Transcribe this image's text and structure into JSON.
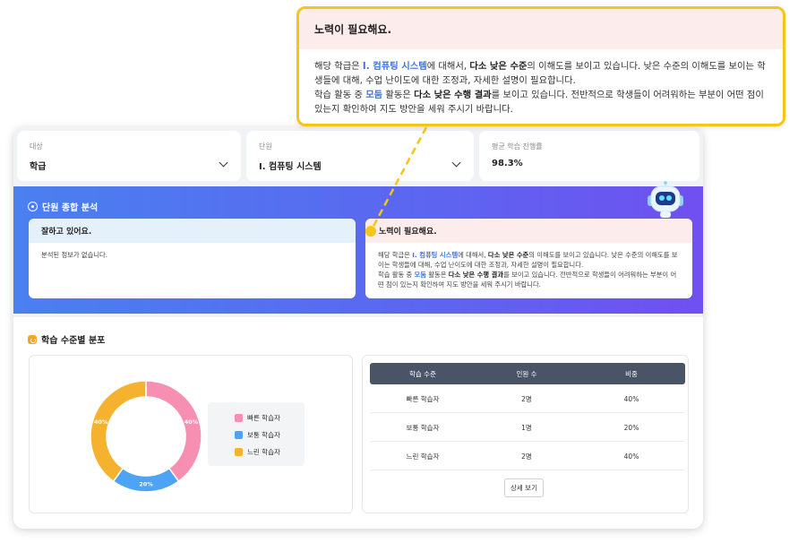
{
  "filters": [
    {
      "label": "대상",
      "value": "학급",
      "has_dropdown": true
    },
    {
      "label": "단원",
      "value": "I. 컴퓨팅 시스템",
      "has_dropdown": true
    },
    {
      "label": "평균 학습 진행률",
      "value": "98.3%",
      "has_dropdown": false
    }
  ],
  "analysis": {
    "title": "단원 종합 분석",
    "good": {
      "header": "잘하고 있어요.",
      "body": "분석된 정보가 없습니다."
    },
    "needs": {
      "header": "노력이 필요해요.",
      "p1_pre": "해당 학급은 ",
      "p1_unit": "I. 컴퓨팅 시스템",
      "p1_mid": "에 대해서, ",
      "p1_bold": "다소 낮은 수준",
      "p1_post": "의 이해도를 보이고 있습니다. 낮은 수준의 이해도를 보이는 학생들에 대해, 수업 난이도에 대한 조정과, 자세한 설명이 필요합니다.",
      "p2_pre": "학습 활동 중 ",
      "p2_act": "모둠",
      "p2_mid": " 활동은 ",
      "p2_bold": "다소 낮은 수행 결과",
      "p2_post": "를 보이고 있습니다. 전반적으로 학생들이 어려워하는 부분이 어떤 점이 있는지 확인하여 지도 방안을 세워 주시기 바랍니다."
    }
  },
  "distribution": {
    "title": "학습 수준별 분포",
    "legend": [
      {
        "name": "빠른 학습자",
        "color": "#f78fb3"
      },
      {
        "name": "보통 학습자",
        "color": "#4da3f5"
      },
      {
        "name": "느린 학습자",
        "color": "#f5b22e"
      }
    ],
    "table": {
      "headers": [
        "학습 수준",
        "인원 수",
        "비중"
      ],
      "rows": [
        [
          "빠른 학습자",
          "2명",
          "40%"
        ],
        [
          "보통 학습자",
          "1명",
          "20%"
        ],
        [
          "느린 학습자",
          "2명",
          "40%"
        ]
      ]
    },
    "detail_button": "상세 보기"
  },
  "chart_data": {
    "type": "pie",
    "categories": [
      "빠른 학습자",
      "보통 학습자",
      "느린 학습자"
    ],
    "values": [
      40,
      20,
      40
    ],
    "data_labels": [
      "40%",
      "20%",
      "40%"
    ],
    "colors": [
      "#f78fb3",
      "#4da3f5",
      "#f5b22e"
    ],
    "donut": true,
    "legend_position": "right"
  }
}
